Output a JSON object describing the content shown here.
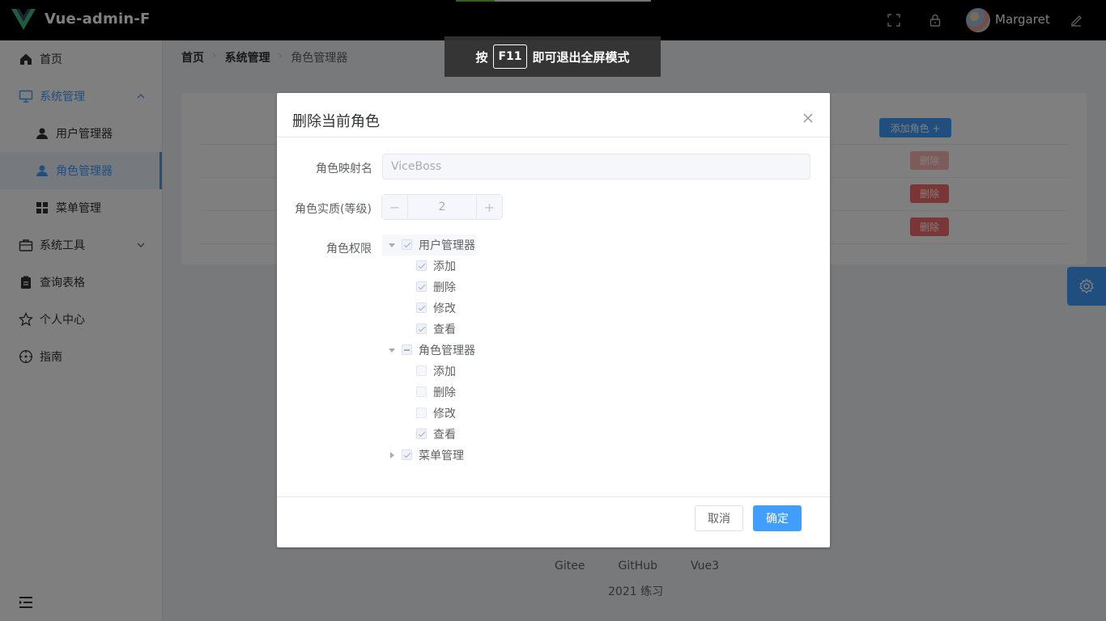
{
  "header": {
    "app_title": "Vue-admin-F",
    "username": "Margaret",
    "icons": [
      "fullscreen-icon",
      "lock-icon",
      "edit-icon"
    ]
  },
  "fullscreen_toast": {
    "prefix": "按",
    "key": "F11",
    "suffix": "即可退出全屏模式"
  },
  "sidebar": {
    "items": [
      {
        "label": "首页",
        "icon": "home-icon"
      },
      {
        "label": "系统管理",
        "icon": "monitor-icon"
      },
      {
        "label": "用户管理器",
        "icon": "user-icon"
      },
      {
        "label": "角色管理器",
        "icon": "user-icon"
      },
      {
        "label": "菜单管理",
        "icon": "grid-icon"
      },
      {
        "label": "系统工具",
        "icon": "briefcase-icon"
      },
      {
        "label": "查询表格",
        "icon": "clipboard-icon"
      },
      {
        "label": "个人中心",
        "icon": "star-icon"
      },
      {
        "label": "指南",
        "icon": "compass-icon"
      }
    ]
  },
  "breadcrumb": [
    "首页",
    "系统管理",
    "角色管理器"
  ],
  "role_table": {
    "add_button": "添加角色 +",
    "delete_label": "删除"
  },
  "footer": {
    "links": [
      "Gitee",
      "GitHub",
      "Vue3"
    ],
    "copyright": "2021 练习"
  },
  "dialog": {
    "title": "删除当前角色",
    "fields": {
      "name_label": "角色映射名",
      "name_value": "ViceBoss",
      "level_label": "角色实质(等级)",
      "level_value": "2",
      "level_minus": "−",
      "level_plus": "+",
      "perm_label": "角色权限"
    },
    "tree": [
      {
        "label": "用户管理器",
        "state": "checked",
        "expanded": true,
        "children": [
          {
            "label": "添加",
            "state": "checked"
          },
          {
            "label": "删除",
            "state": "checked"
          },
          {
            "label": "修改",
            "state": "checked"
          },
          {
            "label": "查看",
            "state": "checked"
          }
        ]
      },
      {
        "label": "角色管理器",
        "state": "indeterminate",
        "expanded": true,
        "children": [
          {
            "label": "添加",
            "state": "unchecked"
          },
          {
            "label": "删除",
            "state": "unchecked"
          },
          {
            "label": "修改",
            "state": "unchecked"
          },
          {
            "label": "查看",
            "state": "checked"
          }
        ]
      },
      {
        "label": "菜单管理",
        "state": "checked",
        "expanded": false,
        "children": []
      }
    ],
    "cancel_label": "取消",
    "confirm_label": "确定"
  },
  "colors": {
    "primary": "#409eff",
    "danger": "#f56c6c",
    "header_bg": "#000000"
  }
}
